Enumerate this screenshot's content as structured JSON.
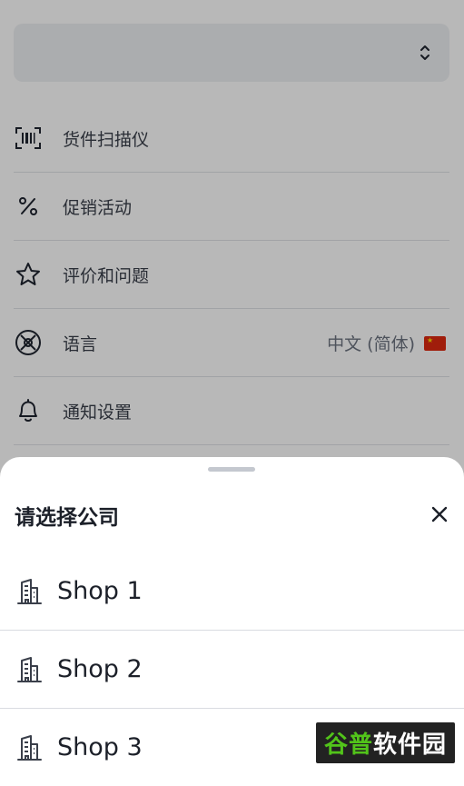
{
  "background": {
    "company_select": {
      "value": "",
      "icon": "chevron-up-down-icon"
    },
    "menu": [
      {
        "icon": "barcode-scan-icon",
        "label": "货件扫描仪"
      },
      {
        "icon": "percent-icon",
        "label": "促销活动"
      },
      {
        "icon": "star-icon",
        "label": "评价和问题"
      },
      {
        "icon": "language-icon",
        "label": "语言",
        "value": "中文 (简体)",
        "flag": "china-flag-icon"
      },
      {
        "icon": "bell-icon",
        "label": "通知设置"
      }
    ]
  },
  "sheet": {
    "title": "请选择公司",
    "close_icon": "close-icon",
    "shops": [
      {
        "icon": "building-icon",
        "name": "Shop 1"
      },
      {
        "icon": "building-icon",
        "name": "Shop 2"
      },
      {
        "icon": "building-icon",
        "name": "Shop 3"
      }
    ]
  },
  "watermark": {
    "part1": "谷普",
    "part2": "软件园"
  },
  "colors": {
    "overlay": "#000000",
    "text": "#1c2029",
    "watermark_green": "#52c41a"
  }
}
